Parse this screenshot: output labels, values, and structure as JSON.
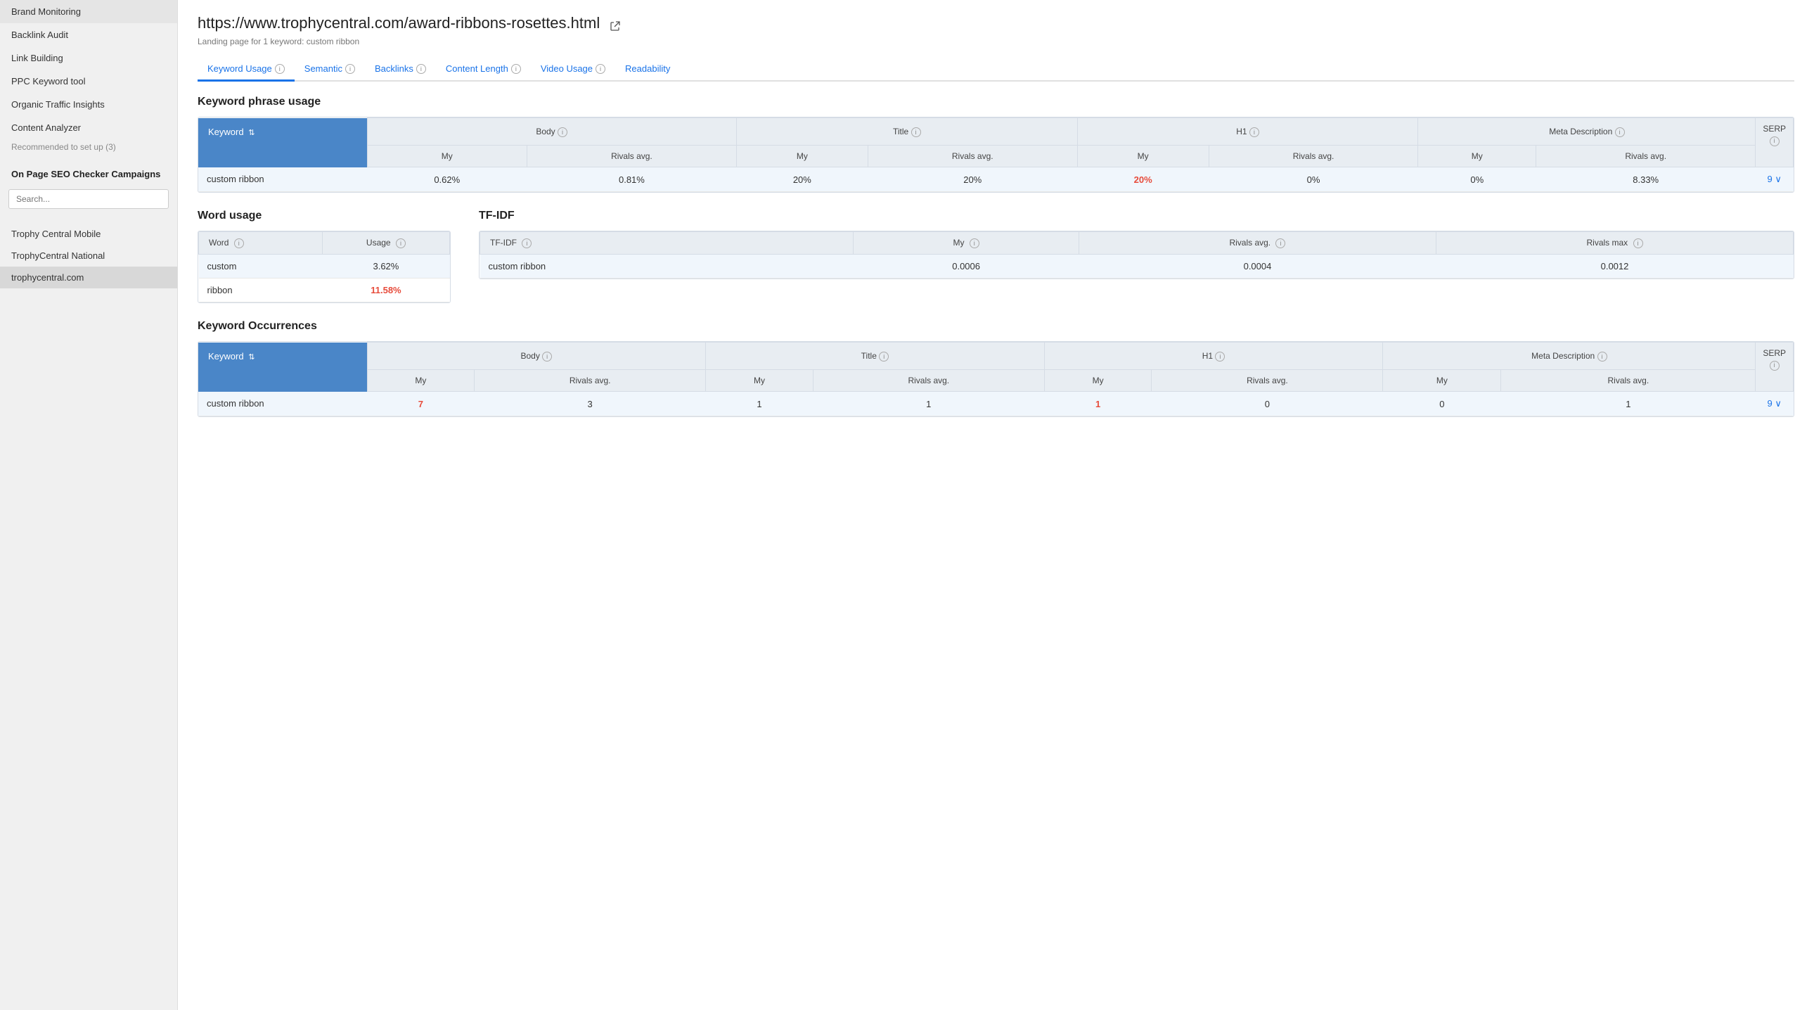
{
  "sidebar": {
    "nav_items": [
      {
        "label": "Brand Monitoring",
        "active": false
      },
      {
        "label": "Backlink Audit",
        "active": false
      },
      {
        "label": "Link Building",
        "active": false
      },
      {
        "label": "PPC Keyword tool",
        "active": false
      },
      {
        "label": "Organic Traffic Insights",
        "active": false
      },
      {
        "label": "Content Analyzer",
        "active": false
      }
    ],
    "recommended_label": "Recommended to set up (3)",
    "section_title": "On Page SEO Checker Campaigns",
    "search_placeholder": "Search...",
    "campaigns": [
      {
        "label": "Trophy Central Mobile",
        "active": false
      },
      {
        "label": "TrophyCentral National",
        "active": false
      },
      {
        "label": "trophycentral.com",
        "active": true
      }
    ]
  },
  "main": {
    "url": "https://www.trophycentral.com/award-ribbons-rosettes.html",
    "subtitle": "Landing page for 1 keyword: custom ribbon",
    "tabs": [
      {
        "label": "Keyword Usage",
        "active": true
      },
      {
        "label": "Semantic"
      },
      {
        "label": "Backlinks"
      },
      {
        "label": "Content Length"
      },
      {
        "label": "Video Usage"
      },
      {
        "label": "Readability"
      }
    ],
    "keyword_phrase_section": {
      "title": "Keyword phrase usage",
      "header_keyword": "Keyword",
      "col_groups": [
        {
          "label": "Body",
          "cols": [
            "My",
            "Rivals avg."
          ]
        },
        {
          "label": "Title",
          "cols": [
            "My",
            "Rivals avg."
          ]
        },
        {
          "label": "H1",
          "cols": [
            "My",
            "Rivals avg."
          ]
        },
        {
          "label": "Meta Description",
          "cols": [
            "My",
            "Rivals avg."
          ]
        }
      ],
      "serp_label": "SERP",
      "rows": [
        {
          "keyword": "custom ribbon",
          "body_my": "0.62%",
          "body_rivals": "0.81%",
          "title_my": "20%",
          "title_rivals": "20%",
          "h1_my": "20%",
          "h1_my_red": true,
          "h1_rivals": "0%",
          "meta_my": "0%",
          "meta_rivals": "8.33%",
          "serp": "9"
        }
      ]
    },
    "word_usage_section": {
      "title": "Word usage",
      "col_word": "Word",
      "col_usage": "Usage",
      "rows": [
        {
          "word": "custom",
          "usage": "3.62%",
          "red": false
        },
        {
          "word": "ribbon",
          "usage": "11.58%",
          "red": true
        }
      ]
    },
    "tfidf_section": {
      "title": "TF-IDF",
      "cols": [
        "TF-IDF",
        "My",
        "Rivals avg.",
        "Rivals max"
      ],
      "rows": [
        {
          "tfidf": "custom ribbon",
          "my": "0.0006",
          "rivals_avg": "0.0004",
          "rivals_max": "0.0012"
        }
      ]
    },
    "keyword_occurrences_section": {
      "title": "Keyword Occurrences",
      "header_keyword": "Keyword",
      "col_groups": [
        {
          "label": "Body",
          "cols": [
            "My",
            "Rivals avg."
          ]
        },
        {
          "label": "Title",
          "cols": [
            "My",
            "Rivals avg."
          ]
        },
        {
          "label": "H1",
          "cols": [
            "My",
            "Rivals avg."
          ]
        },
        {
          "label": "Meta Description",
          "cols": [
            "My",
            "Rivals avg."
          ]
        }
      ],
      "serp_label": "SERP",
      "rows": [
        {
          "keyword": "custom ribbon",
          "body_my": "7",
          "body_my_red": true,
          "body_rivals": "3",
          "title_my": "1",
          "title_rivals": "1",
          "h1_my": "1",
          "h1_my_red": true,
          "h1_rivals": "0",
          "meta_my": "0",
          "meta_rivals": "1",
          "serp": "9"
        }
      ]
    }
  }
}
